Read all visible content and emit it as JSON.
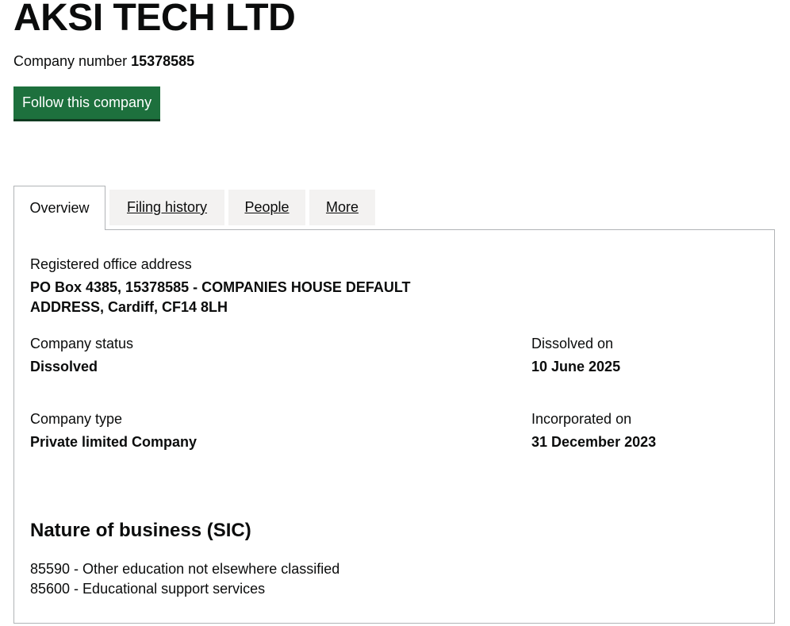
{
  "company": {
    "name": "AKSI TECH LTD",
    "number_label": "Company number",
    "number": "15378585",
    "follow_label": "Follow this company"
  },
  "tabs": [
    {
      "label": "Overview",
      "active": true
    },
    {
      "label": "Filing history",
      "active": false
    },
    {
      "label": "People",
      "active": false
    },
    {
      "label": "More",
      "active": false
    }
  ],
  "overview": {
    "address_label": "Registered office address",
    "address_line1": "PO Box 4385, 15378585 - COMPANIES HOUSE DEFAULT",
    "address_line2": "ADDRESS, Cardiff, CF14 8LH",
    "status_label": "Company status",
    "status_value": "Dissolved",
    "dissolved_label": "Dissolved on",
    "dissolved_value": "10 June 2025",
    "type_label": "Company type",
    "type_value": "Private limited Company",
    "incorporated_label": "Incorporated on",
    "incorporated_value": "31 December 2023",
    "nob_title": "Nature of business (SIC)",
    "sic": [
      "85590 - Other education not elsewhere classified",
      "85600 - Educational support services"
    ]
  },
  "colors": {
    "button_green": "#1d703d",
    "tab_inactive_bg": "#f3f2f1",
    "border_grey": "#b1b4b6",
    "text": "#0b0c0c"
  }
}
